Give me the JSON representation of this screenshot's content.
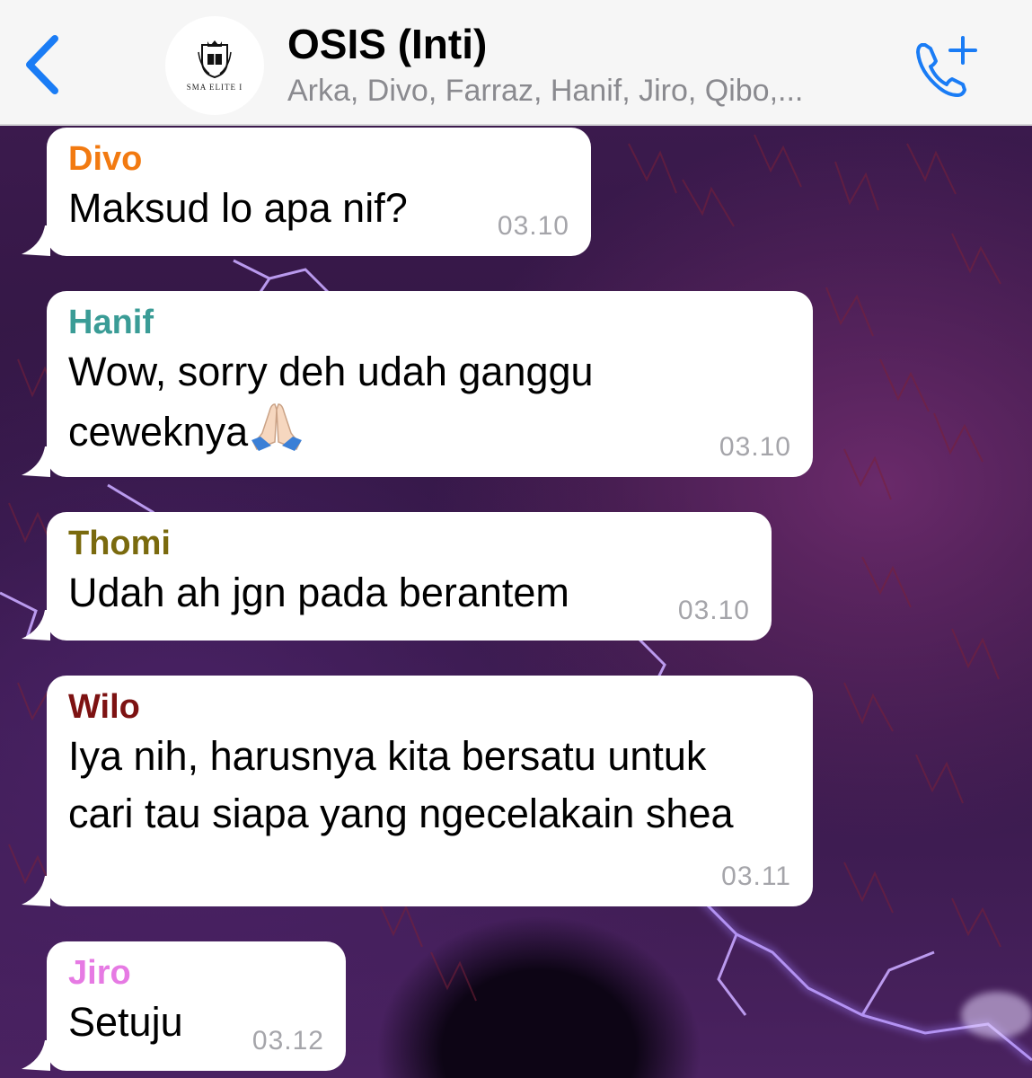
{
  "header": {
    "title": "OSIS (Inti)",
    "subtitle": "Arka, Divo, Farraz, Hanif, Jiro, Qibo,...",
    "avatar_caption": "SMA ELITE I",
    "back_icon": "chevron-left-icon",
    "call_icon": "add-call-icon",
    "accent_color": "#1a7cf5"
  },
  "messages": [
    {
      "sender": "Divo",
      "sender_color": "#f27a11",
      "lines": [
        "Maksud lo apa nif?"
      ],
      "time": "03.10"
    },
    {
      "sender": "Hanif",
      "sender_color": "#3a9c96",
      "lines": [
        "Wow, sorry deh udah ganggu",
        "ceweknya"
      ],
      "emoji": "🙏",
      "emoji_icon": "folded-hands-icon",
      "time": "03.10"
    },
    {
      "sender": "Thomi",
      "sender_color": "#7a6a0e",
      "lines": [
        "Udah ah jgn pada berantem"
      ],
      "time": "03.10"
    },
    {
      "sender": "Wilo",
      "sender_color": "#7d1212",
      "lines": [
        "Iya nih, harusnya kita bersatu untuk",
        "cari tau siapa yang ngecelakain shea"
      ],
      "time": "03.11"
    },
    {
      "sender": "Jiro",
      "sender_color": "#e67ae3",
      "lines": [
        "Setuju"
      ],
      "time": "03.12"
    }
  ]
}
